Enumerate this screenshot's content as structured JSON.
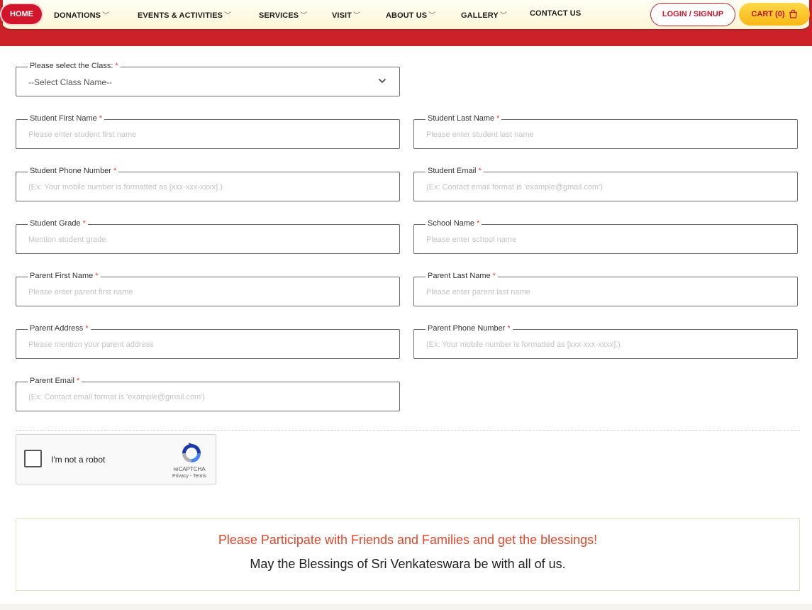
{
  "nav": {
    "home": "HOME",
    "items": [
      {
        "label": "DONATIONS",
        "dropdown": true
      },
      {
        "label": "EVENTS & ACTIVITIES",
        "dropdown": true
      },
      {
        "label": "SERVICES",
        "dropdown": true
      },
      {
        "label": "VISIT",
        "dropdown": true
      },
      {
        "label": "ABOUT US",
        "dropdown": true
      },
      {
        "label": "GALLERY",
        "dropdown": true
      },
      {
        "label": "CONTACT US",
        "dropdown": false
      }
    ],
    "login": "LOGIN / SIGNUP",
    "cart": "CART (0)"
  },
  "form": {
    "class_select": {
      "label": "Please select the Class:",
      "value": "--Select Class Name--"
    },
    "required_mark": "*",
    "fields": [
      {
        "label": "Student First Name",
        "placeholder": "Please enter student first name"
      },
      {
        "label": "Student Last Name",
        "placeholder": "Please enter student last name"
      },
      {
        "label": "Student Phone Number",
        "placeholder": "(Ex: Your mobile number is formatted as [xxx-xxx-xxxx].)"
      },
      {
        "label": "Student Email",
        "placeholder": "(Ex: Contact email format is 'example@gmail.com')"
      },
      {
        "label": "Student Grade",
        "placeholder": "Mention student grade"
      },
      {
        "label": "School Name",
        "placeholder": "Please enter school name"
      },
      {
        "label": "Parent First Name",
        "placeholder": "Please enter parent first name"
      },
      {
        "label": "Parent Last Name",
        "placeholder": "Please enter parent last name"
      },
      {
        "label": "Parent Address",
        "placeholder": "Please mention your parent address"
      },
      {
        "label": "Parent Phone Number",
        "placeholder": "(Ex: Your mobile number is formatted as [xxx-xxx-xxxx].)"
      },
      {
        "label": "Parent Email",
        "placeholder": "(Ex: Contact email format is 'example@gmail.com')"
      }
    ]
  },
  "recaptcha": {
    "label": "I'm not a robot",
    "brand": "reCAPTCHA",
    "links": "Privacy - Terms"
  },
  "message": {
    "line1": "Please Participate with Friends and Families and get the blessings!",
    "line2": "May the Blessings of Sri Venkateswara be with all of us."
  },
  "colors": {
    "brand_red": "#cc2128",
    "accent_yellow": "#f8b814",
    "message_orange": "#e8462b"
  }
}
